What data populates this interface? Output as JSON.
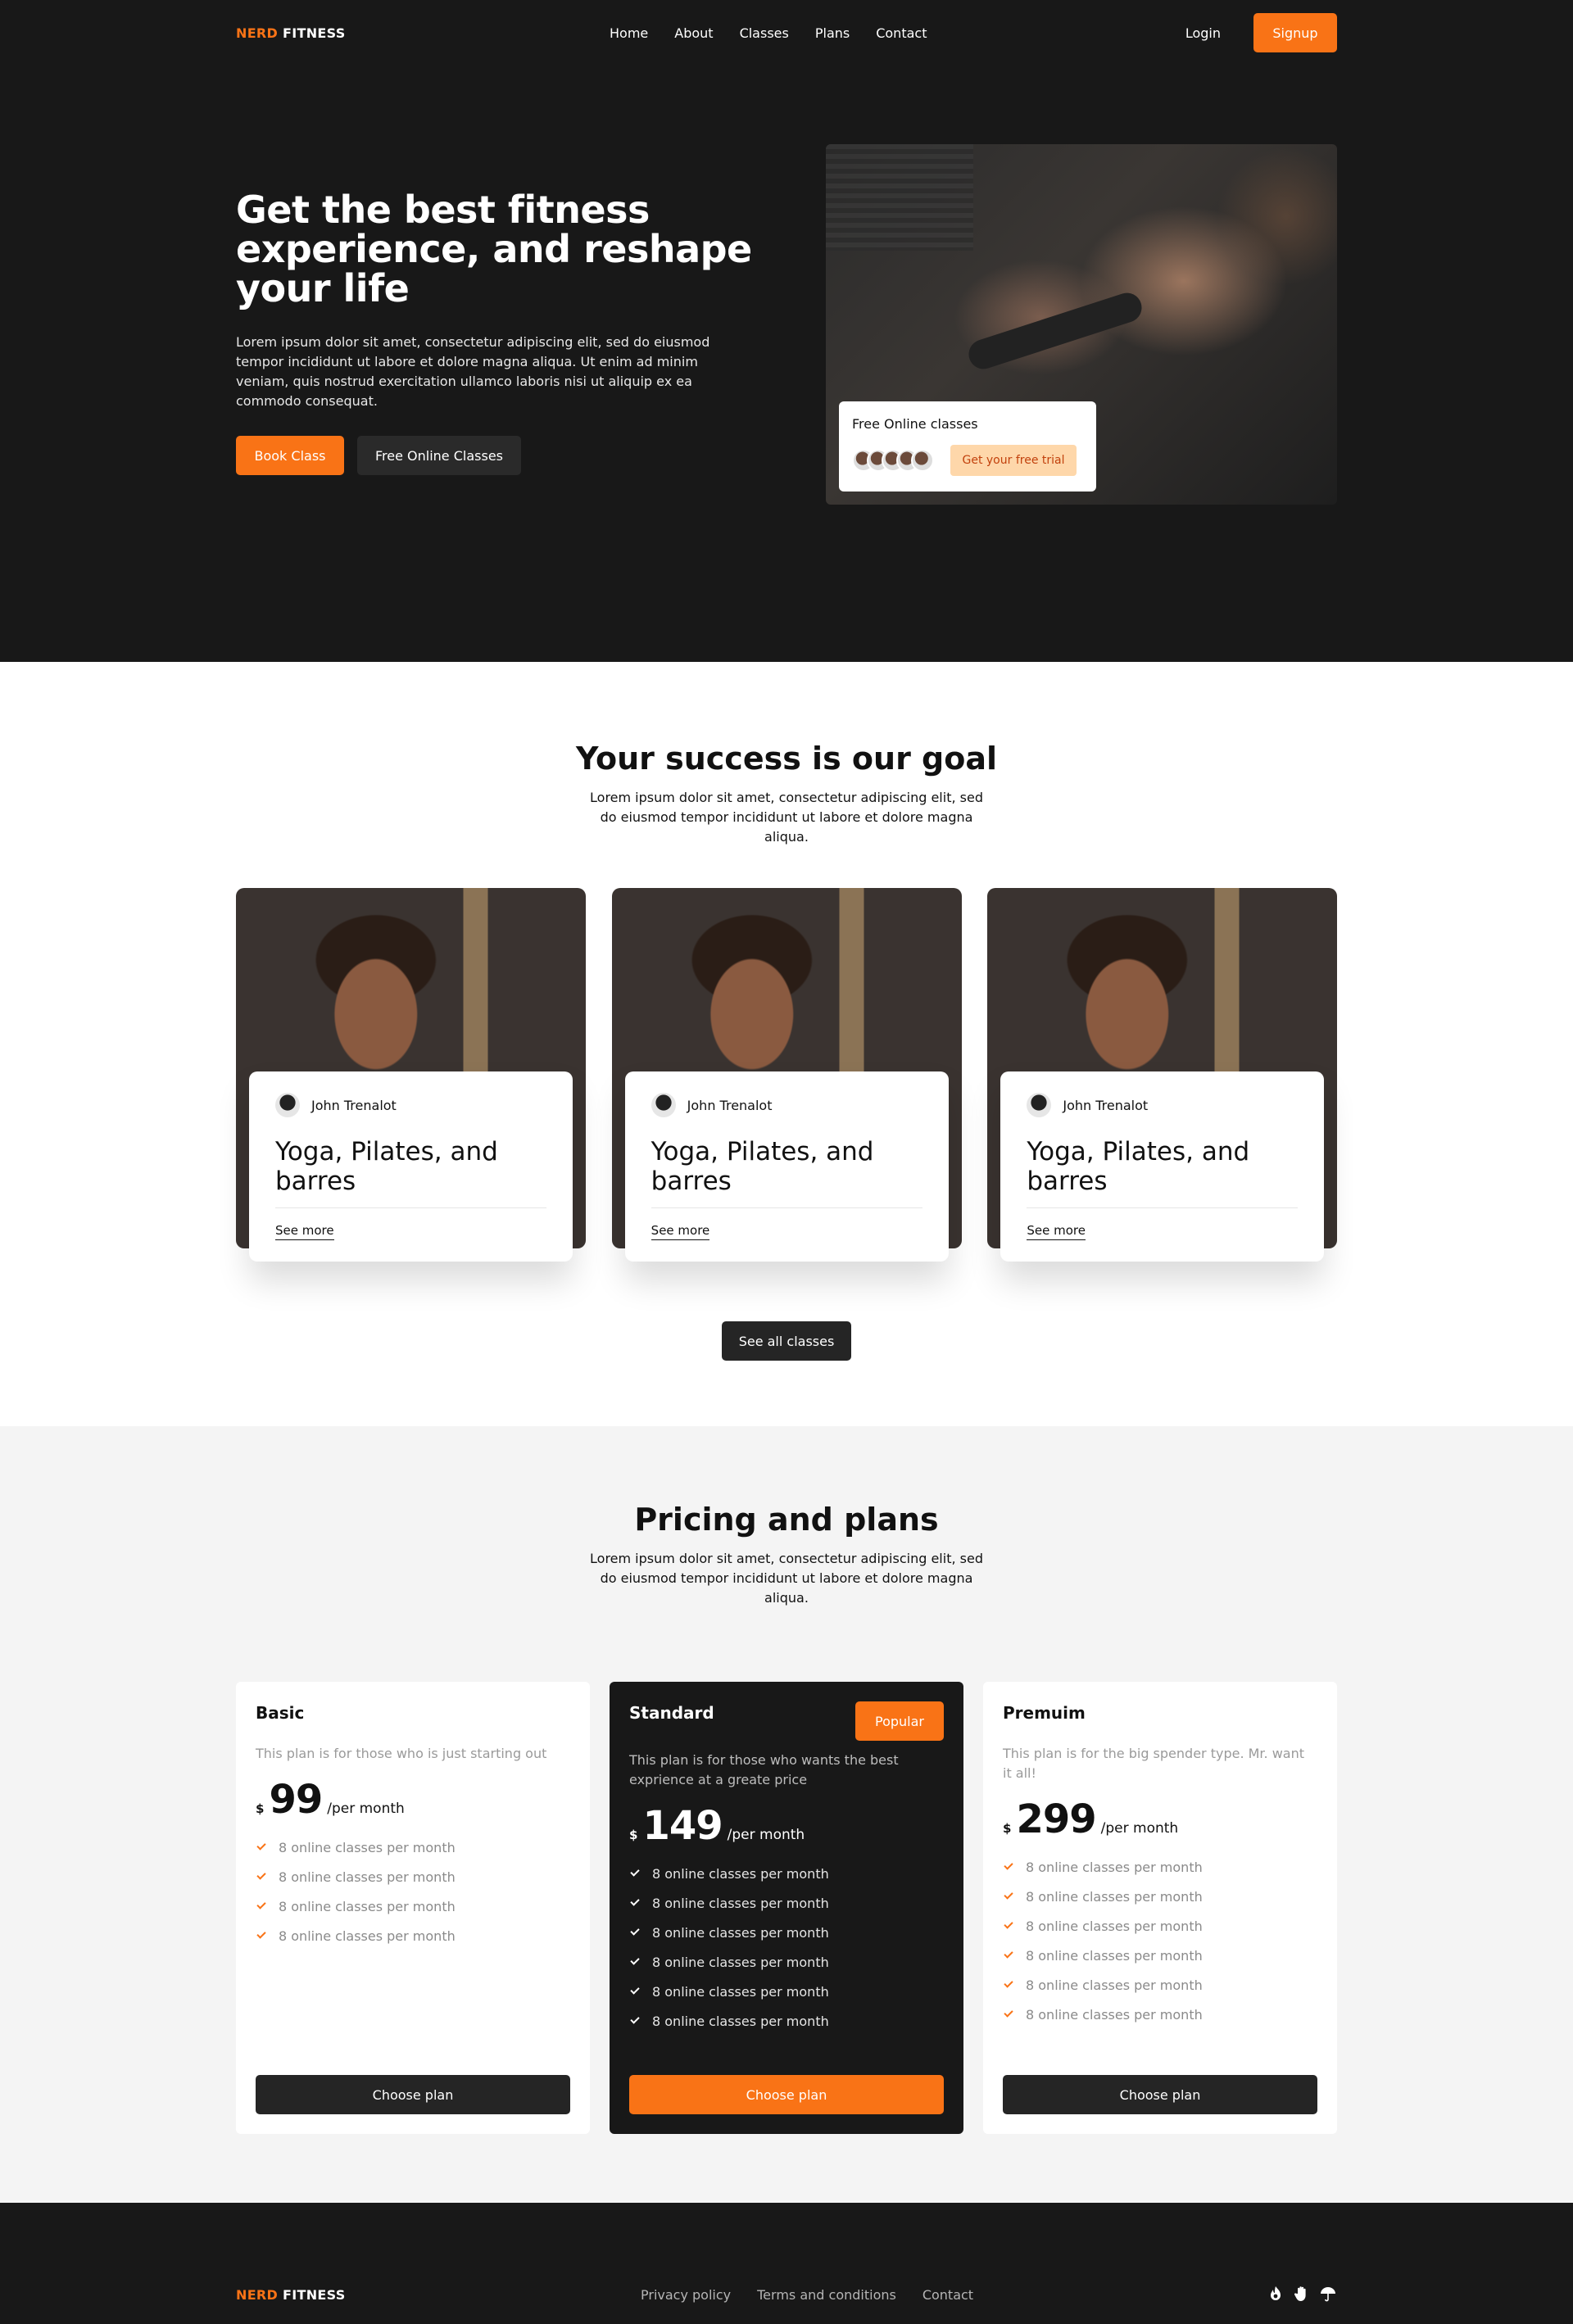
{
  "brand": {
    "first": "NERD",
    "second": "FITNESS",
    "accent_color": "#f97316"
  },
  "nav": {
    "links": [
      "Home",
      "About",
      "Classes",
      "Plans",
      "Contact"
    ],
    "login": "Login",
    "signup": "Signup"
  },
  "hero": {
    "title": "Get the best fitness experience, and reshape your life",
    "text": "Lorem ipsum dolor sit amet, consectetur adipiscing elit, sed do eiusmod tempor incididunt ut labore et dolore magna aliqua. Ut enim ad minim veniam, quis nostrud exercitation ullamco laboris nisi ut aliquip ex ea commodo consequat.",
    "book_button": "Book Class",
    "free_button": "Free Online Classes",
    "free_card": {
      "title": "Free Online classes",
      "trial_button": "Get your free trial"
    }
  },
  "success": {
    "title": "Your success is our goal",
    "subtitle": "Lorem ipsum dolor sit amet, consectetur adipiscing elit, sed do eiusmod tempor incididunt ut labore et dolore magna aliqua.",
    "cards": [
      {
        "author": "John Trenalot",
        "title": "Yoga, Pilates, and barres",
        "link": "See more"
      },
      {
        "author": "John Trenalot",
        "title": "Yoga, Pilates, and barres",
        "link": "See more"
      },
      {
        "author": "John Trenalot",
        "title": "Yoga, Pilates, and barres",
        "link": "See more"
      }
    ],
    "all_button": "See all classes"
  },
  "pricing": {
    "title": "Pricing and plans",
    "subtitle": "Lorem ipsum dolor sit amet, consectetur adipiscing elit, sed do eiusmod tempor incididunt ut labore et dolore magna aliqua.",
    "plans": [
      {
        "name": "Basic",
        "desc": "This plan is for those who is just starting out",
        "currency": "$",
        "price": "99",
        "per": "/per month",
        "features": [
          "8 online classes per month",
          "8 online classes per month",
          "8 online classes per month",
          "8 online classes per month"
        ],
        "button": "Choose plan"
      },
      {
        "name": "Standard",
        "badge": "Popular",
        "desc": "This plan is for those who wants the best exprience at a greate price",
        "currency": "$",
        "price": "149",
        "per": "/per month",
        "features": [
          "8 online classes per month",
          "8 online classes per month",
          "8 online classes per month",
          "8 online classes per month",
          "8 online classes per month",
          "8 online classes per month"
        ],
        "button": "Choose plan"
      },
      {
        "name": "Premuim",
        "desc": "This plan is for the big spender type. Mr. want it all!",
        "currency": "$",
        "price": "299",
        "per": "/per month",
        "features": [
          "8 online classes per month",
          "8 online classes per month",
          "8 online classes per month",
          "8 online classes per month",
          "8 online classes per month",
          "8 online classes per month"
        ],
        "button": "Choose plan"
      }
    ]
  },
  "footer": {
    "links": [
      "Privacy policy",
      "Terms and conditions",
      "Contact"
    ],
    "icons": [
      "fire-icon",
      "hand-icon",
      "umbrella-icon"
    ]
  }
}
